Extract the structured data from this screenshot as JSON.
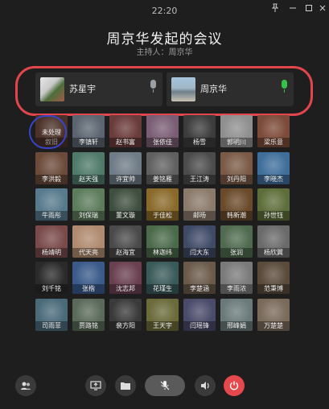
{
  "clock": "22:20",
  "title": "周京华发起的会议",
  "host_label": "主持人：",
  "host_name": "周京华",
  "speakers": [
    {
      "name": "苏星宇",
      "mic_color": "#9aa0a6"
    },
    {
      "name": "周京华",
      "mic_color": "#36c24a"
    }
  ],
  "participants": [
    {
      "name": "未处理",
      "sub": "叙旧",
      "color": "#4b3128"
    },
    {
      "name": "李镇轩",
      "color": "#5b6470"
    },
    {
      "name": "赵书富",
      "color": "#6b3b3b"
    },
    {
      "name": "张依佳",
      "color": "#7a5d74"
    },
    {
      "name": "杨雪",
      "color": "#3c3c3c"
    },
    {
      "name": "郭明川",
      "color": "#8f8f8f"
    },
    {
      "name": "梁乐意",
      "color": "#7c4a38"
    },
    {
      "name": "李洪毅",
      "color": "#6b4a3a"
    },
    {
      "name": "赵天强",
      "color": "#4f7a6a"
    },
    {
      "name": "许宜帅",
      "color": "#6f7b86"
    },
    {
      "name": "姜铭雁",
      "color": "#606060"
    },
    {
      "name": "王江涛",
      "color": "#4b4b4b"
    },
    {
      "name": "刘丹阳",
      "color": "#7a5a46"
    },
    {
      "name": "李晓杰",
      "color": "#3f6e9a"
    },
    {
      "name": "牛雨彤",
      "color": "#577a8c"
    },
    {
      "name": "刘保瑞",
      "color": "#5c7c5c"
    },
    {
      "name": "董文璇",
      "color": "#3f4f3f"
    },
    {
      "name": "于佳松",
      "color": "#8a6a2a"
    },
    {
      "name": "邮旸",
      "color": "#8a7a6a"
    },
    {
      "name": "韩新潮",
      "color": "#6a4a2a"
    },
    {
      "name": "孙世钰",
      "color": "#5e6e3a"
    },
    {
      "name": "杨靖明",
      "color": "#7a4a4a"
    },
    {
      "name": "代天亮",
      "color": "#b08a70"
    },
    {
      "name": "赵海宜",
      "color": "#4a4a4a"
    },
    {
      "name": "林迦纬",
      "color": "#4a6a4a"
    },
    {
      "name": "闫大东",
      "color": "#3f4a66"
    },
    {
      "name": "张润",
      "color": "#4f6a4f"
    },
    {
      "name": "杨欣翼",
      "color": "#6a6a6a"
    },
    {
      "name": "刘千铭",
      "color": "#2a2a2a"
    },
    {
      "name": "张楷",
      "color": "#3a5a8a"
    },
    {
      "name": "沈志邦",
      "color": "#6a4050"
    },
    {
      "name": "花瑾生",
      "color": "#3a5a5a"
    },
    {
      "name": "李楚涵",
      "color": "#6a5a4a"
    },
    {
      "name": "李雨浓",
      "color": "#7a7a7a"
    },
    {
      "name": "范秉博",
      "color": "#5a4a3a"
    },
    {
      "name": "司雨菲",
      "color": "#4a6a7a"
    },
    {
      "name": "贾路铭",
      "color": "#5a6a5a"
    },
    {
      "name": "裴方阳",
      "color": "#3a3a3a"
    },
    {
      "name": "王天宇",
      "color": "#6a6a3a"
    },
    {
      "name": "闫瑶锋",
      "color": "#4a4a6a"
    },
    {
      "name": "邢峰娟",
      "color": "#6a7a7a"
    },
    {
      "name": "万楚楚",
      "color": "#7a6a5a"
    }
  ]
}
